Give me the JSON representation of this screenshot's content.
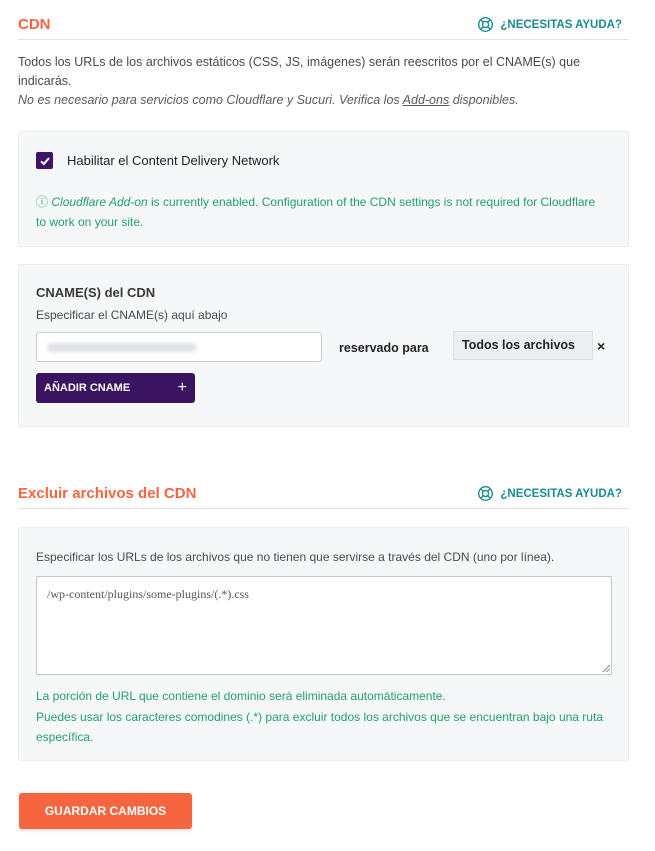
{
  "cdn_section": {
    "title": "CDN",
    "help_label": "¿NECESITAS AYUDA?",
    "intro_line": "Todos los URLs de los archivos estáticos (CSS, JS, imágenes) serán reescritos por el CNAME(s) que indicarás.",
    "note_prefix": "No es necesario para servicios como Cloudflare y Sucuri. Verifica los ",
    "note_link": "Add-ons",
    "note_suffix": " disponibles."
  },
  "enable_panel": {
    "checkbox_label": "Habilitar el Content Delivery Network",
    "checked": true,
    "notice_icon": "ⓘ",
    "notice_addon": "Cloudflare Add-on",
    "notice_text": " is currently enabled. Configuration of the CDN settings is not required for Cloudflare to work on your site."
  },
  "cname_panel": {
    "title": "CNAME(S) del CDN",
    "description": "Especificar el CNAME(s) aquí abajo",
    "reserved_label": "reservado para",
    "select_value": "Todos los archivos",
    "remove_glyph": "×",
    "add_button_label": "AÑADIR CNAME",
    "add_button_glyph": "+"
  },
  "exclude_section": {
    "title": "Excluir archivos del CDN",
    "help_label": "¿NECESITAS AYUDA?",
    "description": "Especificar los URLs de los archivos que no tienen que servirse a través del CDN (uno por línea).",
    "textarea_value": "/wp-content/plugins/some-plugins/(.*).css",
    "help_line_1": "La porción de URL que contiene el dominio será eliminada automáticamente.",
    "help_line_2": "Puedes usar los caracteres comodines (.*) para excluir todos los archivos que se encuentran bajo una ruta específica."
  },
  "footer": {
    "save_label": "GUARDAR CAMBIOS"
  },
  "colors": {
    "accent_orange": "#f56640",
    "teal_help": "#1a8a8f",
    "success_green": "#23a06a",
    "purple": "#40136b"
  }
}
